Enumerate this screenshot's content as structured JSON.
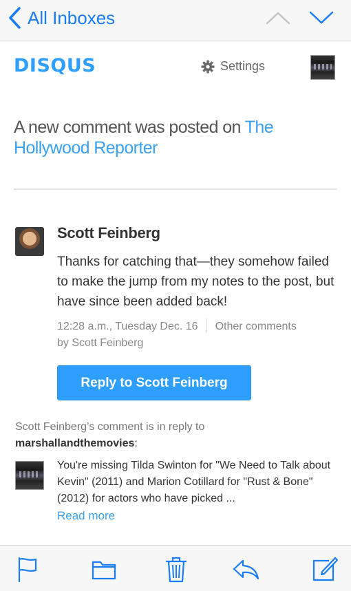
{
  "nav": {
    "back_label": "All Inboxes"
  },
  "header": {
    "logo": "DISQUS",
    "settings_label": "Settings"
  },
  "intro": {
    "text": "A new comment was posted on ",
    "site_link": "The Hollywood Reporter"
  },
  "comment": {
    "author": "Scott Feinberg",
    "body": "Thanks for catching that—they somehow failed to make the jump from my notes to the post, but have since been added back!",
    "timestamp": "12:28 a.m., Tuesday Dec. 16",
    "other_comments": "Other comments",
    "by_line": "by Scott Feinberg",
    "reply_button": "Reply to Scott Feinberg"
  },
  "in_reply": {
    "prefix": "Scott Feinberg’s comment is in reply to",
    "username": "marshallandthemovies",
    "suffix": ":",
    "parent_text": "You're missing Tilda Swinton for \"We Need to Talk about Kevin\" (2011) and Marion Cotillard for \"Rust & Bone\" (2012) for actors who have picked ...",
    "read_more": "Read more"
  },
  "colors": {
    "accent": "#1a7cf5",
    "disqus_blue": "#2e9fff",
    "link": "#3aa0f0"
  },
  "icons": {
    "back": "chevron-left-icon",
    "up": "chevron-up-icon",
    "down": "chevron-down-icon",
    "settings": "gear-icon",
    "flag": "flag-icon",
    "folder": "folder-icon",
    "trash": "trash-icon",
    "reply": "reply-icon",
    "compose": "compose-icon"
  }
}
